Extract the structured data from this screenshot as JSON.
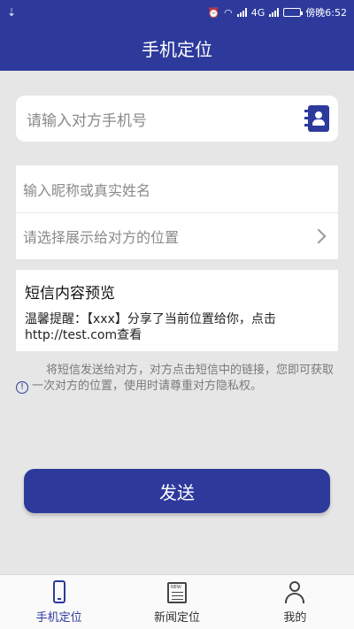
{
  "status_bar": {
    "network_label": "4G",
    "time": "傍晚6:52"
  },
  "app_bar": {
    "title": "手机定位"
  },
  "phone_input": {
    "placeholder": "请输入对方手机号"
  },
  "form": {
    "nickname_placeholder": "输入昵称或真实姓名",
    "location_placeholder": "请选择展示给对方的位置"
  },
  "preview": {
    "title": "短信内容预览",
    "text": "温馨提醒：【xxx】分享了当前位置给你，点击http://test.com查看"
  },
  "notice": {
    "text": "将短信发送给对方，对方点击短信中的链接，您即可获取一次对方的位置，使用时请尊重对方隐私权。"
  },
  "send_button": {
    "label": "发送"
  },
  "bottom_nav": {
    "items": [
      {
        "label": "手机定位",
        "icon": "phone-icon",
        "active": true
      },
      {
        "label": "新闻定位",
        "icon": "newspaper-icon",
        "active": false
      },
      {
        "label": "我的",
        "icon": "user-icon",
        "active": false
      }
    ]
  },
  "colors": {
    "primary": "#2d3a9c",
    "background": "#e6e6e6",
    "placeholder": "#8a8a8a"
  }
}
